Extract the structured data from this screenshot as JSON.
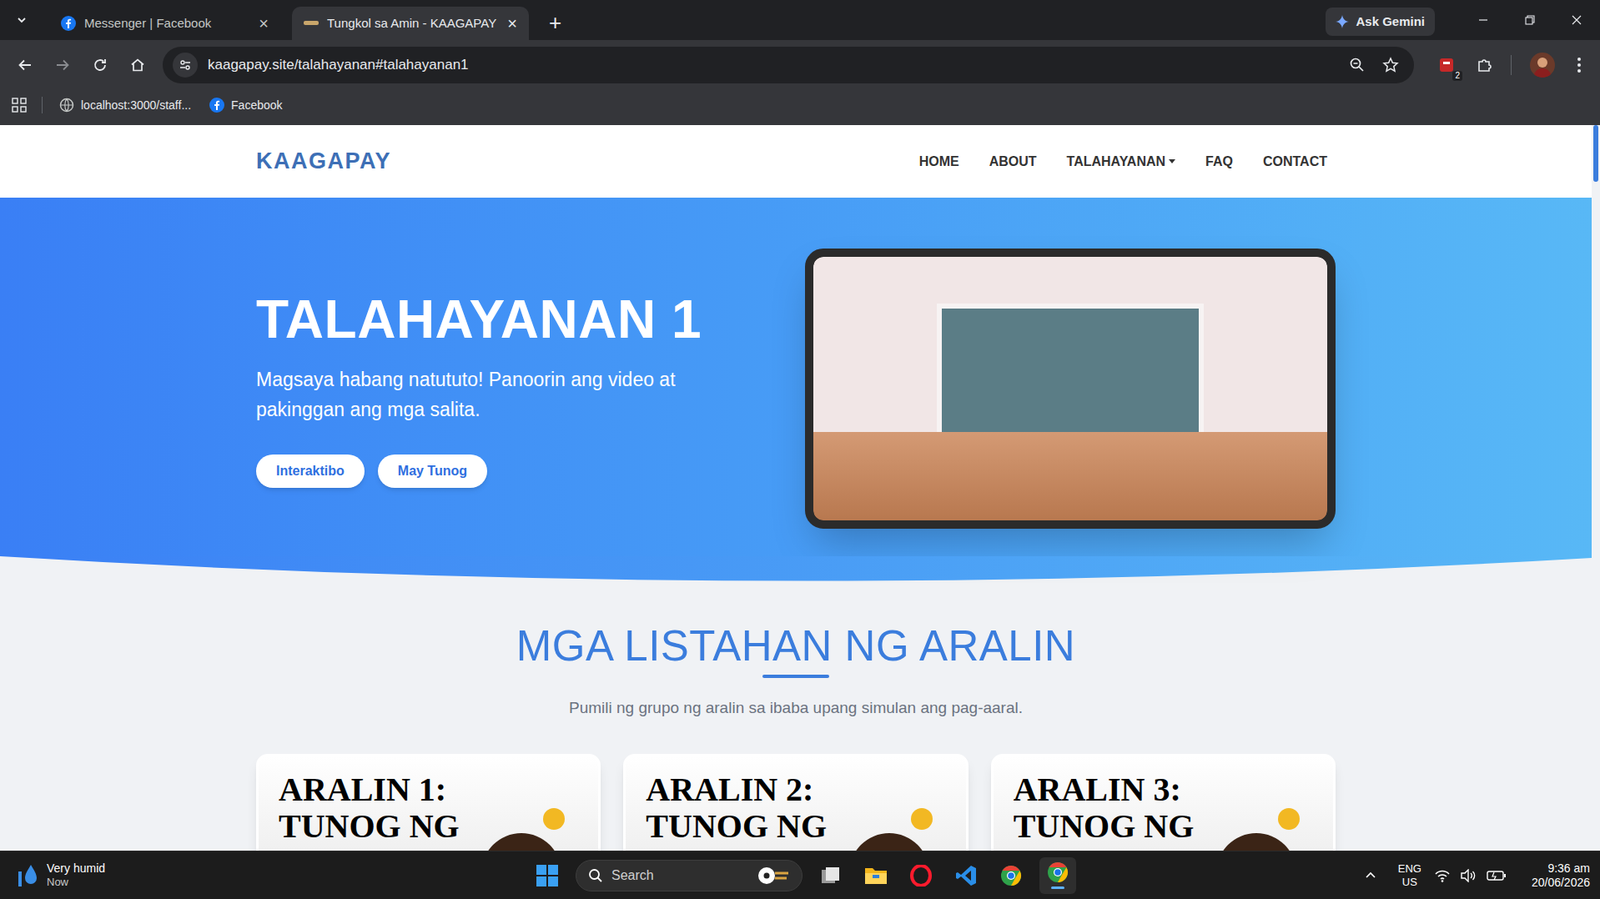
{
  "browser": {
    "tabs": [
      {
        "label": "Messenger | Facebook",
        "close": "×",
        "selected": false
      },
      {
        "label": "Tungkol sa Amin - KAAGAPAY",
        "close": "×",
        "selected": true
      }
    ],
    "new_tab": "+",
    "ask_gemini": "Ask Gemini",
    "address": "kaagapay.site/talahayanan#talahayanan1",
    "extension_badge": "2",
    "bookmarks": [
      {
        "label": "localhost:3000/staff..."
      },
      {
        "label": "Facebook"
      }
    ]
  },
  "site": {
    "logo": "KAAGAPAY",
    "nav": [
      {
        "label": "HOME",
        "dropdown": false
      },
      {
        "label": "ABOUT",
        "dropdown": false
      },
      {
        "label": "TALAHAYANAN",
        "dropdown": true
      },
      {
        "label": "FAQ",
        "dropdown": false
      },
      {
        "label": "CONTACT",
        "dropdown": false
      }
    ],
    "hero": {
      "title": "TALAHAYANAN 1",
      "text": "Magsaya habang natututo! Panoorin ang video at pakinggan ang mga salita.",
      "buttons": [
        "Interaktibo",
        "May Tunog"
      ]
    },
    "section": {
      "title": "MGA LISTAHAN NG ARALIN",
      "subtitle": "Pumili ng grupo ng aralin sa ibaba upang simulan ang pag-aaral."
    },
    "lessons": [
      {
        "line1": "ARALIN 1:",
        "line2": "TUNOG NG"
      },
      {
        "line1": "ARALIN 2:",
        "line2": "TUNOG NG"
      },
      {
        "line1": "ARALIN 3:",
        "line2": "TUNOG NG"
      }
    ]
  },
  "taskbar": {
    "weather": {
      "label": "Very humid",
      "time": "Now"
    },
    "search": "Search",
    "language": "ENG",
    "region": "US",
    "time": "9:36 am",
    "date": "20/06/2026"
  }
}
